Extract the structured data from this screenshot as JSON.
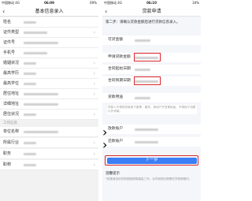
{
  "left": {
    "status": {
      "carrier": "中国移动  4G",
      "time": "06:09",
      "battery": "69%"
    },
    "nav": {
      "back": "‹",
      "title": "基本信息录入"
    },
    "rows": [
      {
        "label": "姓名"
      },
      {
        "label": "证件类型"
      },
      {
        "label": "证件号"
      },
      {
        "label": "手机号"
      },
      {
        "label": "婚姻状况"
      },
      {
        "label": "最高学历"
      },
      {
        "label": "最高学位"
      },
      {
        "label": "居住地址"
      },
      {
        "label": "详细地址"
      },
      {
        "label": "居住状况"
      },
      {
        "label": "单位名称"
      },
      {
        "label": "所属行业"
      },
      {
        "label": "职务"
      },
      {
        "label": "职称"
      }
    ],
    "section": "工作信息"
  },
  "right": {
    "status": {
      "carrier": "中国移动  4G",
      "time": "06:10",
      "battery": "34%"
    },
    "nav": {
      "back": "‹",
      "title": "贷款申请"
    },
    "step_tip": "第二步：请确认贷款金额后进行贷款信息录入。",
    "rows": [
      {
        "label": "可贷金额"
      },
      {
        "label": "申请贷款金额"
      },
      {
        "label": "合同起始日期"
      },
      {
        "label": "合同到期日期"
      },
      {
        "label": "贷款用途"
      }
    ],
    "purpose_note": "贷款人不得将贷款用于股票、期货、房地产开发等用途，不得用于消费以外领域。",
    "accounts": [
      {
        "label": "放款账户"
      },
      {
        "label": "还款账户"
      }
    ],
    "next_button": "下一步",
    "tips_title": "温馨提示",
    "tips_body": "*前渠道信用贷款额度期限最高三年，合同到期日期需在贷款期限内。"
  },
  "colors": {
    "accent": "#3b7ff6",
    "highlight": "#d9262a"
  }
}
